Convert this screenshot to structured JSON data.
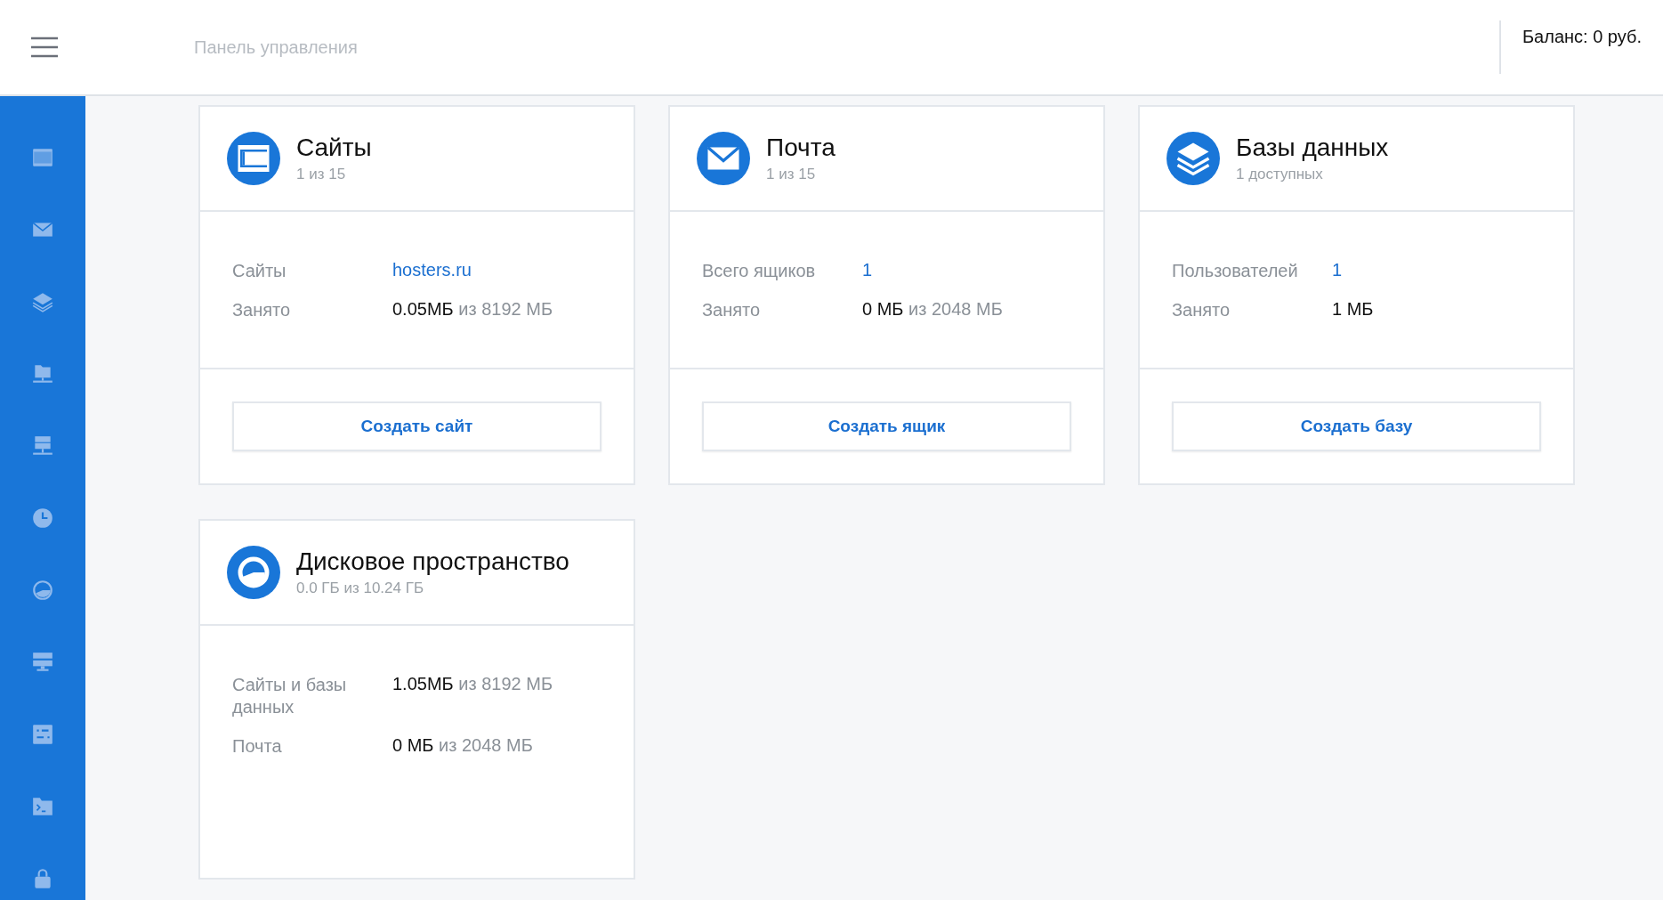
{
  "header": {
    "title": "Панель управления",
    "balance": "Баланс: 0 руб."
  },
  "cards": [
    {
      "title": "Сайты",
      "subtitle": "1 из 15",
      "rows": [
        {
          "label": "Сайты",
          "kind": "link",
          "value": "hosters.ru"
        },
        {
          "label": "Занято",
          "kind": "usage",
          "value": "0.05МБ",
          "total": "из 8192 МБ"
        }
      ],
      "button": "Создать сайт"
    },
    {
      "title": "Почта",
      "subtitle": "1 из 15",
      "rows": [
        {
          "label": "Всего ящиков",
          "kind": "number",
          "value": "1"
        },
        {
          "label": "Занято",
          "kind": "usage",
          "value": "0 МБ",
          "total": "из 2048 МБ"
        }
      ],
      "button": "Создать ящик"
    },
    {
      "title": "Базы данных",
      "subtitle": "1 доступных",
      "rows": [
        {
          "label": "Пользователей",
          "kind": "number",
          "value": "1"
        },
        {
          "label": "Занято",
          "kind": "usage",
          "value": "1 МБ"
        }
      ],
      "button": "Создать базу"
    },
    {
      "title": "Дисковое пространство",
      "subtitle": "0.0 ГБ из 10.24 ГБ",
      "rows": [
        {
          "label": "Сайты и базы данных",
          "kind": "usage",
          "value": "1.05МБ",
          "total": "из 8192 МБ"
        },
        {
          "label": "Почта",
          "kind": "usage",
          "value": "0 МБ",
          "total": "из 2048 МБ"
        }
      ]
    }
  ]
}
